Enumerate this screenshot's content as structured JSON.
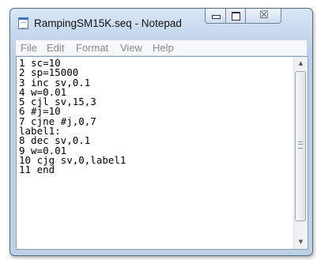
{
  "window": {
    "title": "RampingSM15K.seq - Notepad",
    "icon": "notepad-icon",
    "controls": {
      "minimize_icon": "minimize-icon",
      "maximize_icon": "maximize-icon",
      "close_glyph": "☒"
    }
  },
  "menu": {
    "file": "File",
    "edit": "Edit",
    "format": "Format",
    "view": "View",
    "help": "Help"
  },
  "document": {
    "lines": [
      "1 sc=10",
      "2 sp=15000",
      "3 inc sv,0.1",
      "4 w=0.01",
      "5 cjl sv,15,3",
      "6 #j=10",
      "7 cjne #j,0,7",
      "label1:",
      "8 dec sv,0.1",
      "9 w=0.01",
      "10 cjg sv,0,label1",
      "11 end"
    ]
  },
  "scrollbar": {
    "up_glyph": "▲",
    "down_glyph": "▼"
  }
}
